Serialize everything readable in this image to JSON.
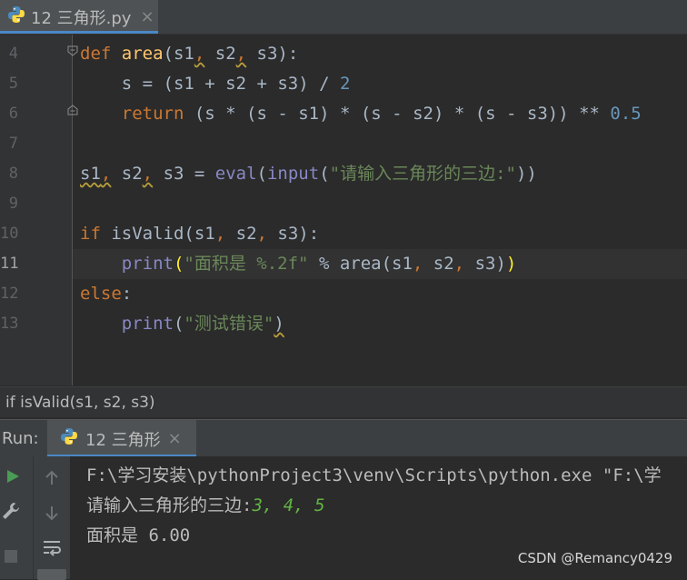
{
  "editor": {
    "file_tab": {
      "label": "12 三角形.py",
      "close": "×",
      "icon": "python-file-icon"
    },
    "lines": [
      {
        "n": "4",
        "segments": [
          [
            "kw",
            "def"
          ],
          [
            "t",
            " "
          ],
          [
            "fn",
            "area"
          ],
          [
            "t",
            "(s1"
          ],
          [
            "kw",
            ","
          ],
          [
            "t",
            " s2"
          ],
          [
            "kw",
            ","
          ],
          [
            "t",
            " s3):"
          ]
        ]
      },
      {
        "n": "5",
        "segments": [
          [
            "t",
            "    s = (s1 + s2 + s3) / "
          ],
          [
            "num",
            "2"
          ]
        ]
      },
      {
        "n": "6",
        "segments": [
          [
            "t",
            "    "
          ],
          [
            "kw",
            "return"
          ],
          [
            "t",
            " (s * (s - s1) * (s - s2) * (s - s3)) ** "
          ],
          [
            "num",
            "0.5"
          ]
        ]
      },
      {
        "n": "7",
        "segments": []
      },
      {
        "n": "8",
        "segments": [
          [
            "t",
            "s1"
          ],
          [
            "kw",
            ","
          ],
          [
            "t",
            " s2"
          ],
          [
            "kw",
            ","
          ],
          [
            "t",
            " s3 = "
          ],
          [
            "builtin",
            "eval"
          ],
          [
            "t",
            "("
          ],
          [
            "builtin",
            "input"
          ],
          [
            "t",
            "("
          ],
          [
            "str",
            "\"请输入三角形的三边:\""
          ],
          [
            "t",
            "))"
          ]
        ]
      },
      {
        "n": "9",
        "segments": []
      },
      {
        "n": "10",
        "segments": [
          [
            "kw",
            "if"
          ],
          [
            "t",
            " isValid(s1"
          ],
          [
            "kw",
            ","
          ],
          [
            "t",
            " s2"
          ],
          [
            "kw",
            ","
          ],
          [
            "t",
            " s3):"
          ]
        ]
      },
      {
        "n": "11",
        "segments": [
          [
            "t",
            "    "
          ],
          [
            "builtin",
            "print"
          ],
          [
            "match",
            "("
          ],
          [
            "str",
            "\"面积是 %.2f\""
          ],
          [
            "t",
            " % area(s1"
          ],
          [
            "kw",
            ","
          ],
          [
            "t",
            " s2"
          ],
          [
            "kw",
            ","
          ],
          [
            "t",
            " s3)"
          ],
          [
            "match",
            ")"
          ]
        ]
      },
      {
        "n": "12",
        "segments": [
          [
            "kw",
            "else"
          ],
          [
            "t",
            ":"
          ]
        ]
      },
      {
        "n": "13",
        "segments": [
          [
            "t",
            "    "
          ],
          [
            "builtin",
            "print"
          ],
          [
            "t",
            "("
          ],
          [
            "str",
            "\"测试错误\""
          ],
          [
            "t",
            ")"
          ]
        ]
      }
    ],
    "current_line": "11",
    "breadcrumb": "if isValid(s1, s2, s3)"
  },
  "run": {
    "label": "Run:",
    "tab": {
      "label": "12 三角形",
      "close": "×",
      "icon": "python-file-icon"
    },
    "console_lines": [
      {
        "text": "F:\\学习安装\\pythonProject3\\venv\\Scripts\\python.exe \"F:\\学"
      },
      {
        "text": "请输入三角形的三边:",
        "input": "3, 4, 5"
      },
      {
        "text": "面积是 6.00"
      }
    ],
    "tools_left": [
      "rerun-icon",
      "wrench-icon",
      "stop-icon"
    ],
    "tools_right": [
      "up-arrow-icon",
      "down-arrow-icon",
      "soft-wrap-icon",
      "scroll-to-end-icon"
    ]
  },
  "watermark": "CSDN @Remancy0429",
  "colors": {
    "keyword": "#cc7832",
    "function": "#ffc66d",
    "number": "#6897bb",
    "string": "#6a8759",
    "builtin": "#8888c6",
    "input_echo": "#62b543"
  }
}
